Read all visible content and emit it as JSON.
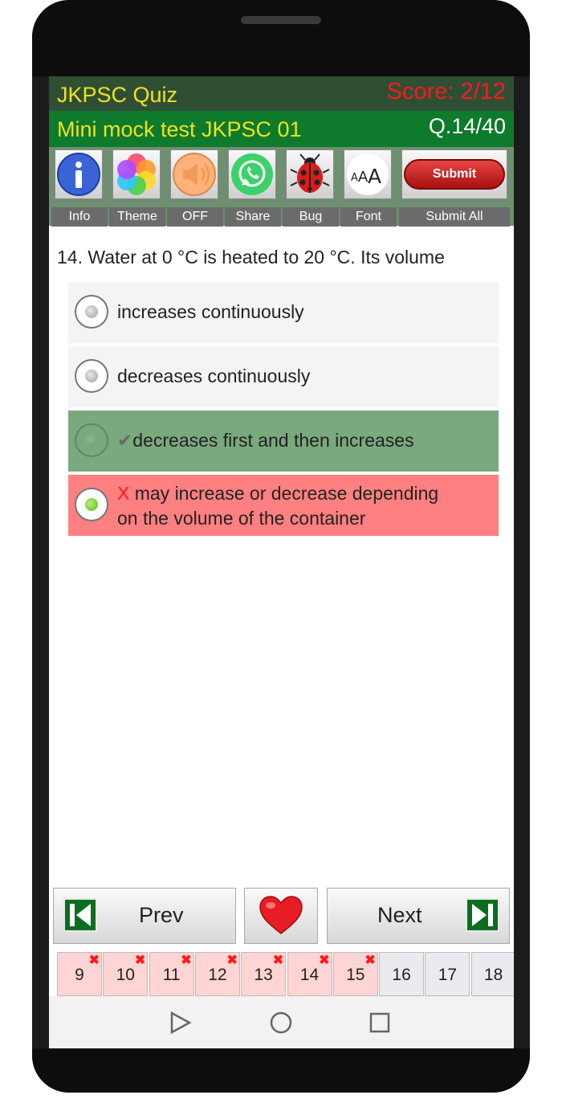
{
  "header": {
    "app_title": "JKPSC Quiz",
    "score": "Score: 2/12",
    "test_name": "Mini mock test JKPSC 01",
    "question_counter": "Q.14/40"
  },
  "toolbar": {
    "items": [
      {
        "label": "Info",
        "icon": "info-icon"
      },
      {
        "label": "Theme",
        "icon": "theme-icon"
      },
      {
        "label": "OFF",
        "icon": "speaker-icon"
      },
      {
        "label": "Share",
        "icon": "whatsapp-icon"
      },
      {
        "label": "Bug",
        "icon": "ladybug-icon"
      },
      {
        "label": "Font",
        "icon": "font-size-icon"
      }
    ],
    "submit_button": "Submit",
    "submit_all": "Submit All"
  },
  "question": {
    "text": "14. Water at 0 °C is heated to 20 °C. Its volume",
    "options": [
      {
        "text": "increases continuously",
        "state": "neutral"
      },
      {
        "text": "decreases continuously",
        "state": "neutral"
      },
      {
        "mark": "✔",
        "text": "decreases first and then increases",
        "state": "correct"
      },
      {
        "mark": "X",
        "line1": "may increase or decrease depending",
        "line2": "on the volume of the container",
        "state": "wrong-selected"
      }
    ]
  },
  "colors": {
    "correct_bg": "#7aa97d",
    "wrong_bg": "#ff8080",
    "neutral_bg": "#f4f4f4",
    "title_bar": "#2f4f35",
    "sub_bar": "#0d7a2c"
  },
  "navigation": {
    "prev": "Prev",
    "next": "Next",
    "favorite_icon": "heart-icon"
  },
  "question_strip": [
    {
      "num": "9",
      "wrong": true
    },
    {
      "num": "10",
      "wrong": true
    },
    {
      "num": "11",
      "wrong": true
    },
    {
      "num": "12",
      "wrong": true
    },
    {
      "num": "13",
      "wrong": true
    },
    {
      "num": "14",
      "wrong": true
    },
    {
      "num": "15",
      "wrong": true
    },
    {
      "num": "16",
      "wrong": false
    },
    {
      "num": "17",
      "wrong": false
    },
    {
      "num": "18",
      "wrong": false
    }
  ],
  "question_strip_mark": "✖"
}
